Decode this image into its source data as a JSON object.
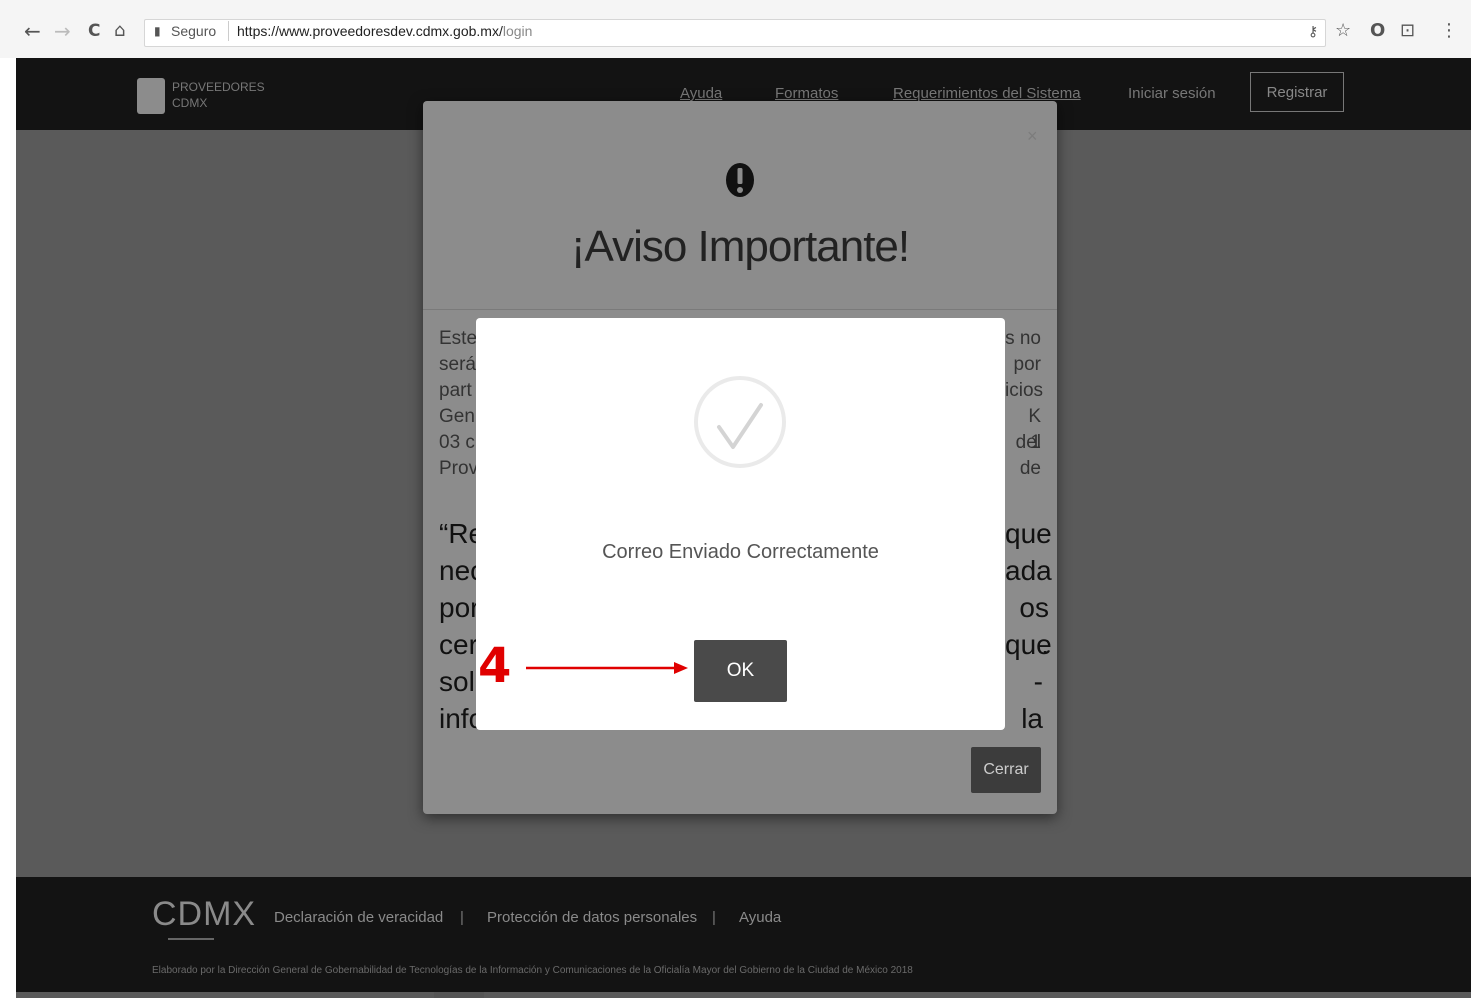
{
  "browser": {
    "back_icon": "←",
    "forward_icon": "→",
    "reload_icon": "C",
    "home_icon": "⌂",
    "secure_label": "Seguro",
    "url_main": "https://www.proveedoresdev.cdmx.gob.mx/",
    "url_path": "login",
    "key_icon": "⚷",
    "star_icon": "☆",
    "opera_icon": "O",
    "cast_icon": "⊡",
    "menu_icon": "⋮"
  },
  "site": {
    "logo_line1": "PROVEEDORES",
    "logo_line2": "CDMX",
    "nav": {
      "help": "Ayuda",
      "formats": "Formatos",
      "requirements": "Requerimientos del Sistema",
      "login": "Iniciar sesión",
      "register": "Registrar"
    },
    "footer": {
      "logo": "CDMX",
      "declaration": "Declaración de veracidad",
      "privacy": "Protección de datos personales",
      "help": "Ayuda",
      "separator": "|",
      "credit": "Elaborado por la Dirección General de Gobernabilidad de Tecnologías de la Información y Comunicaciones de la Oficialía Mayor del Gobierno de la Ciudad de México 2018"
    }
  },
  "modal": {
    "close": "×",
    "icon": "exclamation-icon",
    "title": "¡Aviso Importante!",
    "left_fragments": [
      "Este",
      "será",
      "part",
      "Gen",
      "03 c",
      "Prov"
    ],
    "right_fragments": [
      "s no",
      "por",
      "icios",
      "K del",
      "1 de"
    ],
    "bold_left": [
      "“Re",
      "nec",
      "por",
      "cer",
      "soli",
      "info"
    ],
    "bold_right": [
      "que",
      "ada",
      "os .",
      "que",
      "- la"
    ],
    "close_button": "Cerrar"
  },
  "alert": {
    "icon": "checkmark-icon",
    "message": "Correo Enviado Correctamente",
    "ok_button": "OK"
  },
  "annotation": {
    "step": "4",
    "color": "#e00000"
  }
}
